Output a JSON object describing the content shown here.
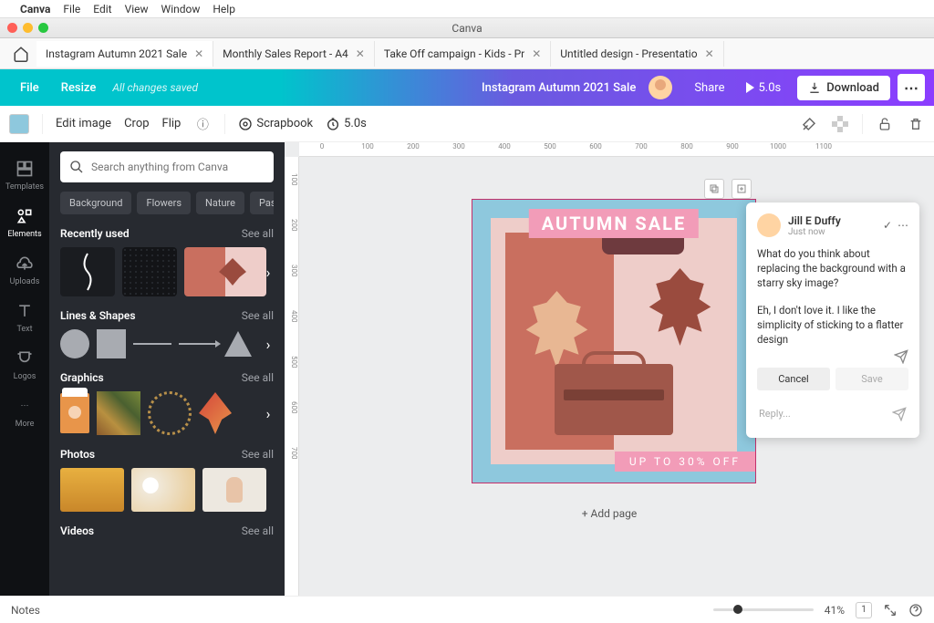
{
  "mac_menu": {
    "app": "Canva",
    "items": [
      "File",
      "Edit",
      "View",
      "Window",
      "Help"
    ]
  },
  "window_title": "Canva",
  "doc_tabs": [
    {
      "label": "Instagram Autumn 2021 Sale",
      "active": true
    },
    {
      "label": "Monthly Sales Report - A4",
      "active": false
    },
    {
      "label": "Take Off campaign - Kids - Pr",
      "active": false
    },
    {
      "label": "Untitled design - Presentatio",
      "active": false
    }
  ],
  "topbar": {
    "file": "File",
    "resize": "Resize",
    "saved": "All changes saved",
    "title": "Instagram Autumn 2021 Sale",
    "share": "Share",
    "play_time": "5.0s",
    "download": "Download"
  },
  "ctx": {
    "edit_image": "Edit image",
    "crop": "Crop",
    "flip": "Flip",
    "scrapbook": "Scrapbook",
    "time": "5.0s"
  },
  "rail": [
    {
      "id": "templates",
      "label": "Templates"
    },
    {
      "id": "elements",
      "label": "Elements"
    },
    {
      "id": "uploads",
      "label": "Uploads"
    },
    {
      "id": "text",
      "label": "Text"
    },
    {
      "id": "logos",
      "label": "Logos"
    },
    {
      "id": "more",
      "label": "More"
    }
  ],
  "panel": {
    "search_placeholder": "Search anything from Canva",
    "chips": [
      "Background",
      "Flowers",
      "Nature",
      "Pastel b"
    ],
    "see_all": "See all",
    "sections": {
      "recent": "Recently used",
      "lines": "Lines & Shapes",
      "graphics": "Graphics",
      "photos": "Photos",
      "videos": "Videos"
    }
  },
  "ruler_h": [
    "0",
    "100",
    "200",
    "300",
    "400",
    "500",
    "600",
    "700",
    "800",
    "900",
    "1000",
    "1100"
  ],
  "ruler_v": [
    "100",
    "200",
    "300",
    "400",
    "500",
    "600",
    "700"
  ],
  "design": {
    "title": "AUTUMN SALE",
    "sub": "UP TO 30% OFF"
  },
  "add_page": "+ Add page",
  "comment": {
    "name": "Jill E Duffy",
    "time": "Just now",
    "text": "What do you think about replacing the background with a starry sky image?",
    "draft": "Eh, I don't love it. I like the simplicity of sticking to a flatter design",
    "cancel": "Cancel",
    "save": "Save",
    "reply_ph": "Reply..."
  },
  "footer": {
    "notes": "Notes",
    "zoom": "41%",
    "page": "1"
  }
}
